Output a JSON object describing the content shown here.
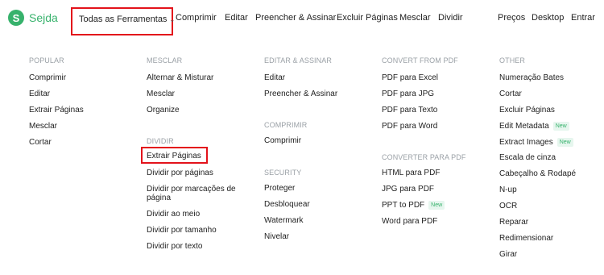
{
  "brand": {
    "name": "Sejda",
    "logo_letter": "S"
  },
  "nav": {
    "all_tools": "Todas as Ferramentas",
    "compress": "Comprimir",
    "edit": "Editar",
    "fill_sign": "Preencher & Assinar",
    "delete_pages": "Excluir Páginas",
    "merge": "Mesclar",
    "split": "Dividir",
    "pricing": "Preços",
    "desktop": "Desktop",
    "login": "Entrar"
  },
  "menu": {
    "popular": {
      "heading": "POPULAR",
      "items": [
        "Comprimir",
        "Editar",
        "Extrair Páginas",
        "Mesclar",
        "Cortar"
      ]
    },
    "merge": {
      "heading": "MESCLAR",
      "items": [
        "Alternar & Misturar",
        "Mesclar",
        "Organize"
      ]
    },
    "split": {
      "heading": "DIVIDIR",
      "items": [
        "Extrair Páginas",
        "Dividir por páginas",
        "Dividir por marcações de",
        "página",
        "Dividir ao meio",
        "Dividir por tamanho",
        "Dividir por texto"
      ]
    },
    "edit_sign": {
      "heading": "EDITAR & ASSINAR",
      "items": [
        "Editar",
        "Preencher & Assinar"
      ]
    },
    "compress": {
      "heading": "COMPRIMIR",
      "items": [
        "Comprimir"
      ]
    },
    "security": {
      "heading": "SECURITY",
      "items": [
        "Proteger",
        "Desbloquear",
        "Watermark",
        "Nivelar"
      ]
    },
    "convert_from": {
      "heading": "CONVERT FROM PDF",
      "items": [
        "PDF para Excel",
        "PDF para JPG",
        "PDF para Texto",
        "PDF para Word"
      ]
    },
    "convert_to": {
      "heading": "CONVERTER PARA PDF",
      "items": [
        "HTML para PDF",
        "JPG para PDF",
        "PPT to PDF",
        "Word para PDF"
      ]
    },
    "other": {
      "heading": "OTHER",
      "items": [
        "Numeração Bates",
        "Cortar",
        "Excluir Páginas",
        "Edit Metadata",
        "Extract Images",
        "Escala de cinza",
        "Cabeçalho & Rodapé",
        "N-up",
        "OCR",
        "Reparar",
        "Redimensionar",
        "Girar"
      ]
    },
    "new_badge": "New"
  },
  "colors": {
    "brand_green": "#37b26c",
    "highlight_red": "#e3131b",
    "heading_gray": "#9aa0a6"
  }
}
